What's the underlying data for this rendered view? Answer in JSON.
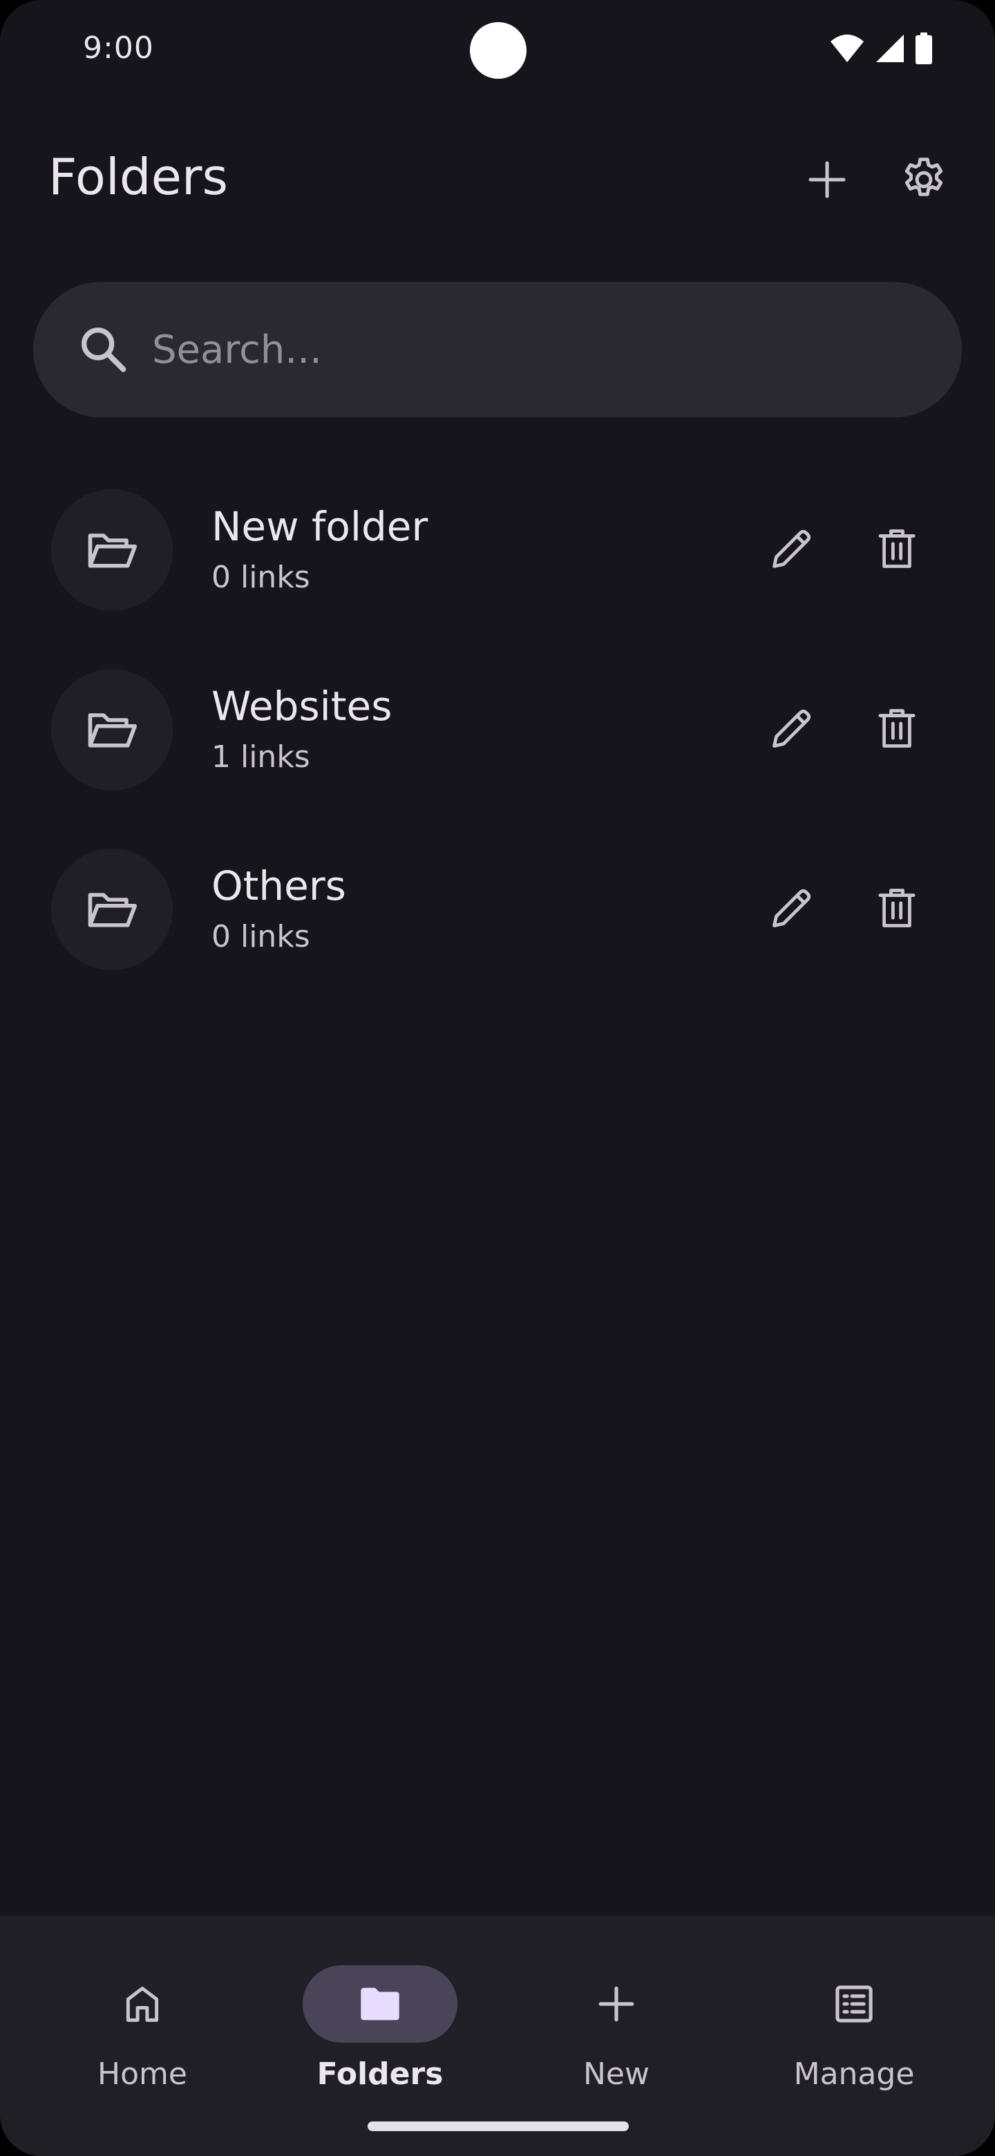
{
  "status_bar": {
    "time": "9:00"
  },
  "app_bar": {
    "title": "Folders"
  },
  "search": {
    "placeholder": "Search..."
  },
  "folders": [
    {
      "name": "New folder",
      "count": "0 links"
    },
    {
      "name": "Websites",
      "count": "1 links"
    },
    {
      "name": "Others",
      "count": "0 links"
    }
  ],
  "bottom_nav": {
    "items": [
      {
        "label": "Home",
        "icon": "home-icon",
        "active": false
      },
      {
        "label": "Folders",
        "icon": "folder-icon",
        "active": true
      },
      {
        "label": "New",
        "icon": "plus-icon",
        "active": false
      },
      {
        "label": "Manage",
        "icon": "list-icon",
        "active": false
      }
    ]
  },
  "colors": {
    "background": "#17151C",
    "surface": "#2B2930",
    "nav_background": "#211F26",
    "active_indicator": "#4A4458",
    "active_icon": "#E8DDFF",
    "on_surface": "#ECE6F0",
    "on_surface_variant": "#CAC4D0"
  }
}
